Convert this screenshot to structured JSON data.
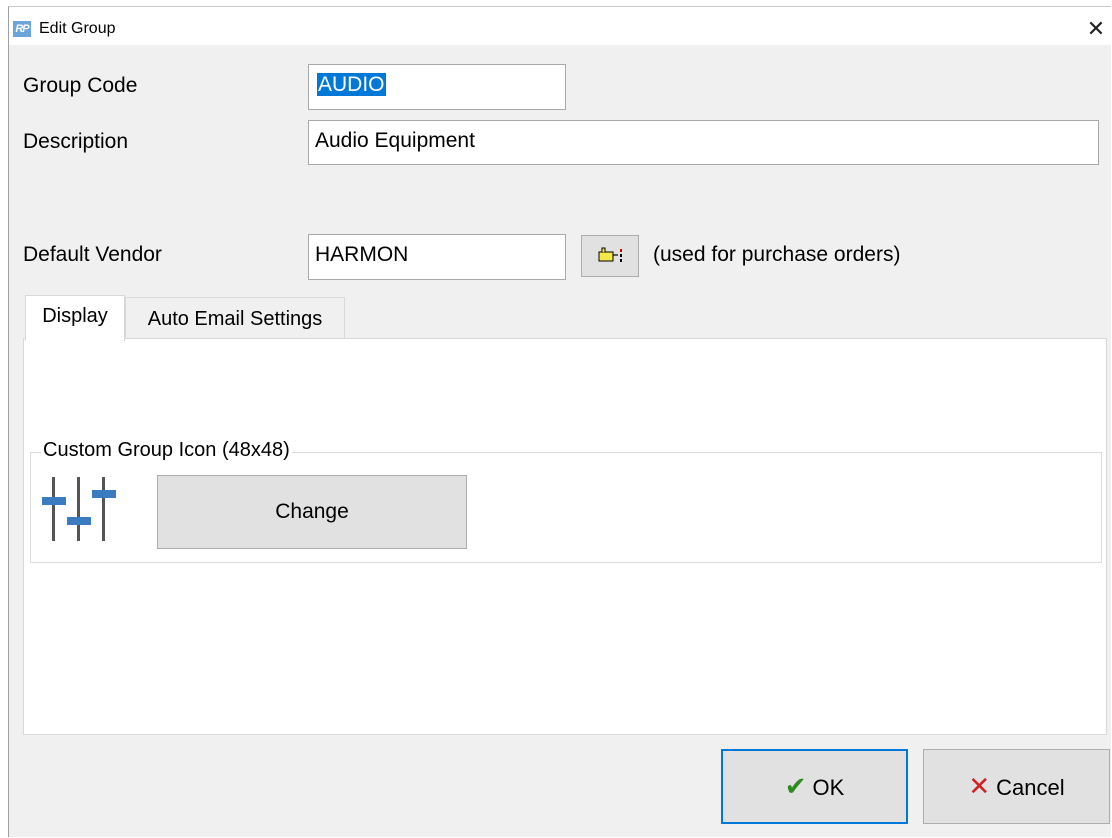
{
  "window": {
    "title": "Edit Group",
    "app_icon_text": "RP",
    "close_glyph": "✕"
  },
  "form": {
    "group_code": {
      "label": "Group Code",
      "value": "AUDIO"
    },
    "description": {
      "label": "Description",
      "value": "Audio Equipment"
    },
    "default_vendor": {
      "label": "Default Vendor",
      "value": "HARMON",
      "lookup_icon": "hand-pointer-icon",
      "hint": "(used for purchase orders)"
    }
  },
  "tabs": [
    {
      "label": "Display",
      "active": true
    },
    {
      "label": "Auto Email Settings",
      "active": false
    }
  ],
  "display_tab": {
    "groupbox_label": "Custom Group Icon (48x48)",
    "icon": "sliders-icon",
    "change_label": "Change"
  },
  "buttons": {
    "ok_label": "OK",
    "cancel_label": "Cancel"
  },
  "colors": {
    "accent": "#0078d7",
    "icon_blue": "#3b7cc1",
    "ok_green": "#2e8b1f",
    "cancel_red": "#d21f1f"
  }
}
